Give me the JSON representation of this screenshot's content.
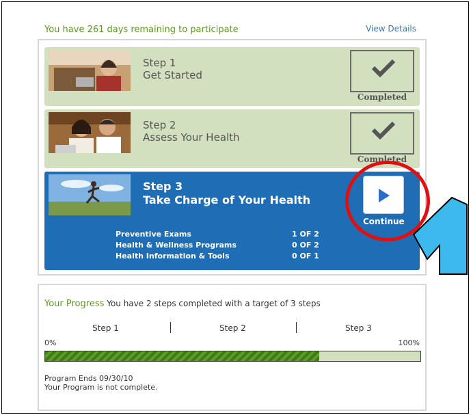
{
  "header": {
    "remaining_message": "You have 261 days remaining to participate",
    "view_details": "View Details"
  },
  "steps": [
    {
      "number": "Step 1",
      "name": "Get Started",
      "status": "Completed"
    },
    {
      "number": "Step 2",
      "name": "Assess Your Health",
      "status": "Completed"
    },
    {
      "number": "Step 3",
      "name": "Take Charge of Your Health",
      "action": "Continue",
      "details": [
        {
          "label": "Preventive Exams",
          "value": "1 OF 2"
        },
        {
          "label": "Health & Wellness Programs",
          "value": "0 OF 2"
        },
        {
          "label": "Health Information & Tools",
          "value": "0 OF 1"
        }
      ]
    }
  ],
  "progress": {
    "title": "Your Progress",
    "summary": "You have 2 steps completed with a target of 3 steps",
    "step_labels": [
      "Step 1",
      "Step 2",
      "Step 3"
    ],
    "min_label": "0%",
    "max_label": "100%",
    "fill_fraction": 0.73,
    "program_ends": "Program Ends 09/30/10",
    "status_text": "Your Program is not complete."
  },
  "colors": {
    "accent_green": "#5a9a1a",
    "step_done_bg": "#d3e0bf",
    "step_active_bg": "#1f6eb5",
    "highlight_red": "#e01010",
    "arrow_blue": "#3db9ee"
  },
  "icons": {
    "check": "check-icon",
    "play": "play-icon",
    "arrow": "pointer-arrow-icon"
  }
}
